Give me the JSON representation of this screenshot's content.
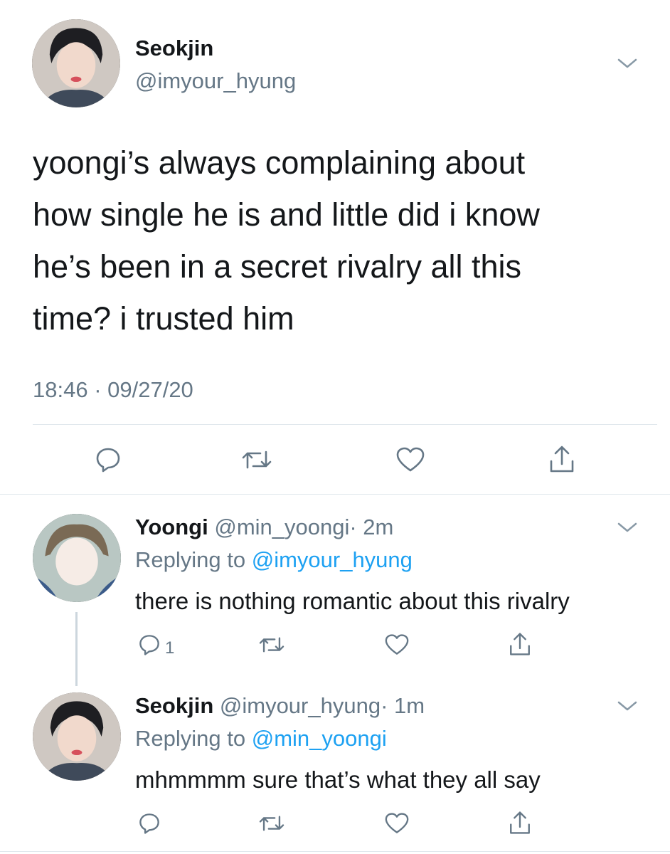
{
  "main_tweet": {
    "display_name": "Seokjin",
    "handle": "@imyour_hyung",
    "text_lines": [
      "yoongi’s always complaining about",
      "how single he is and little did i know",
      "he’s been in a secret rivalry all this",
      "time? i trusted him"
    ],
    "timestamp": "18:46 · 09/27/20"
  },
  "replies": [
    {
      "display_name": "Yoongi",
      "handle": "@min_yoongi",
      "time": "· 2m",
      "replying_prefix": "Replying to",
      "replying_handle": "@imyour_hyung",
      "text": "there is nothing romantic about this rivalry",
      "reply_count": "1"
    },
    {
      "display_name": "Seokjin",
      "handle": "@imyour_hyung",
      "time": "· 1m",
      "replying_prefix": "Replying to",
      "replying_handle": "@min_yoongi",
      "text": "mhmmmm sure that’s what they all say",
      "reply_count": ""
    }
  ],
  "icons": [
    "chevron-down-icon",
    "reply-icon",
    "retweet-icon",
    "like-icon",
    "share-icon"
  ],
  "colors": {
    "link": "#1da1f2",
    "muted": "#657786",
    "divider": "#e1e8ed",
    "text": "#14171a"
  }
}
